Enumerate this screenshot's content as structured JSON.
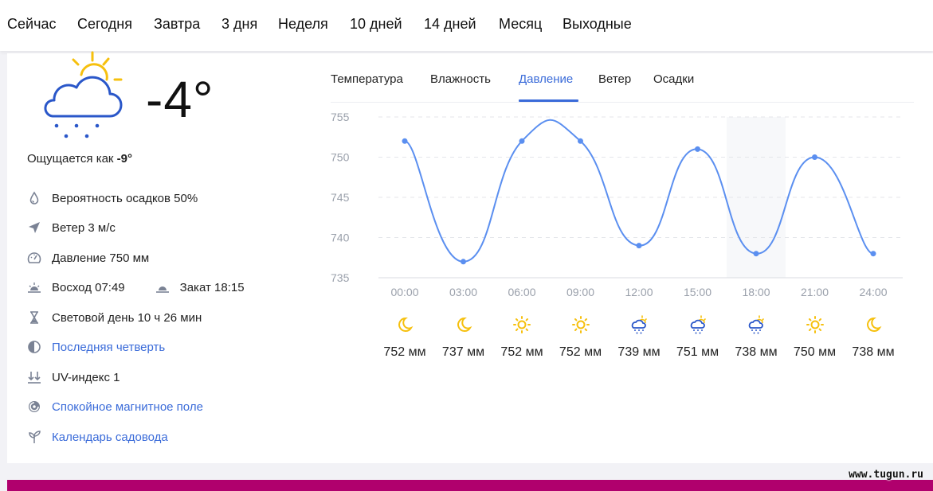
{
  "nav": [
    "Сейчас",
    "Сегодня",
    "Завтра",
    "3 дня",
    "Неделя",
    "10 дней",
    "14 дней",
    "Месяц",
    "Выходные"
  ],
  "current": {
    "icon": "cloud-sun-snow-icon",
    "temperature": "-4°",
    "feels_like_label": "Ощущается как",
    "feels_like_value": "-9°"
  },
  "details": [
    {
      "icon": "drop-icon",
      "text": "Вероятность осадков 50%",
      "link": false
    },
    {
      "icon": "wind-arrow-icon",
      "text": "Ветер 3 м/с",
      "link": false
    },
    {
      "icon": "gauge-icon",
      "text": "Давление 750 мм",
      "link": false
    },
    {
      "icon": "hourglass-icon",
      "text": "Световой день 10 ч 26 мин",
      "link": false
    },
    {
      "icon": "moon-phase-icon",
      "text": "Последняя четверть",
      "link": true
    },
    {
      "icon": "uv-icon",
      "text": "UV-индекс 1",
      "link": false
    },
    {
      "icon": "magnet-icon",
      "text": "Спокойное магнитное поле",
      "link": true
    },
    {
      "icon": "sprout-icon",
      "text": "Календарь садовода",
      "link": true
    }
  ],
  "sun": {
    "sunrise": "Восход 07:49",
    "sunset": "Закат 18:15"
  },
  "tabs": [
    "Температура",
    "Влажность",
    "Давление",
    "Ветер",
    "Осадки"
  ],
  "active_tab": "Давление",
  "colors": {
    "accent": "#3a6bd9",
    "line": "#5b8ff0",
    "sun": "#f6c00e",
    "stripe": "#b0006d"
  },
  "chart_data": {
    "type": "line",
    "x": [
      "00:00",
      "03:00",
      "06:00",
      "09:00",
      "12:00",
      "15:00",
      "18:00",
      "21:00",
      "24:00"
    ],
    "values": [
      752,
      737,
      752,
      752,
      739,
      751,
      738,
      750,
      738
    ],
    "ylim": [
      735,
      755
    ],
    "yticks": [
      755,
      750,
      745,
      740,
      735
    ],
    "value_labels": [
      "752 мм",
      "737 мм",
      "752 мм",
      "752 мм",
      "739 мм",
      "751 мм",
      "738 мм",
      "750 мм",
      "738 мм"
    ],
    "weather_icons": [
      "moon-icon",
      "moon-icon",
      "sun-icon",
      "sun-icon",
      "cloud-snow-sun-icon",
      "cloud-snow-sun-icon",
      "cloud-snow-sun-icon",
      "sun-icon",
      "moon-icon"
    ],
    "highlight_x": "18:00",
    "grid": true
  },
  "watermark": "www.tugun.ru"
}
